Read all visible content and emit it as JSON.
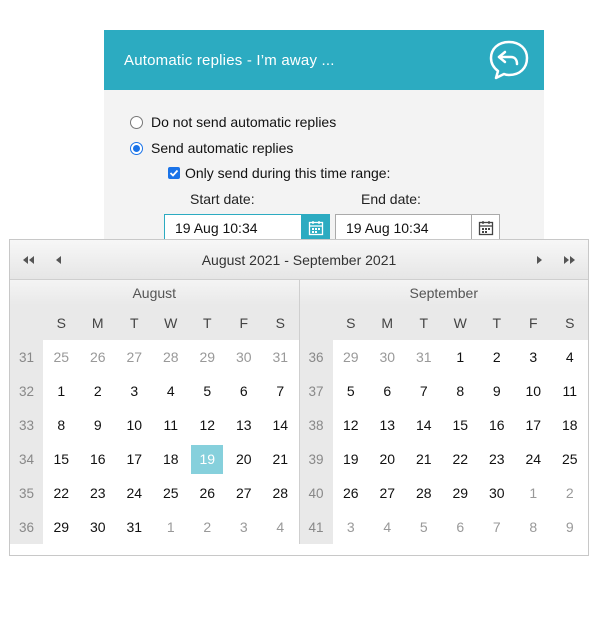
{
  "dialog": {
    "title": "Automatic replies - I’m away ...",
    "options": [
      {
        "label": "Do not send automatic replies",
        "checked": false
      },
      {
        "label": "Send automatic replies",
        "checked": true
      }
    ],
    "time_range_label": "Only send during this time range:",
    "time_range_checked": true,
    "start_label": "Start date:",
    "start_value": "19 Aug 10:34",
    "end_label": "End date:",
    "end_value": "19 Aug 10:34"
  },
  "colors": {
    "header": "#2cabc1",
    "selected_day": "#86d0dc",
    "accent": "#1a73e8"
  },
  "calendar": {
    "title": "August 2021 - September 2021",
    "weekday_headers": [
      "S",
      "M",
      "T",
      "W",
      "T",
      "F",
      "S"
    ],
    "months": [
      {
        "name": "August",
        "weeks": [
          "31",
          "32",
          "33",
          "34",
          "35",
          "36"
        ],
        "days": [
          [
            "25",
            "26",
            "27",
            "28",
            "29",
            "30",
            "31"
          ],
          [
            "1",
            "2",
            "3",
            "4",
            "5",
            "6",
            "7"
          ],
          [
            "8",
            "9",
            "10",
            "11",
            "12",
            "13",
            "14"
          ],
          [
            "15",
            "16",
            "17",
            "18",
            "19",
            "20",
            "21"
          ],
          [
            "22",
            "23",
            "24",
            "25",
            "26",
            "27",
            "28"
          ],
          [
            "29",
            "30",
            "31",
            "1",
            "2",
            "3",
            "4"
          ]
        ],
        "other": [
          [
            1,
            1,
            1,
            1,
            1,
            1,
            1
          ],
          [
            0,
            0,
            0,
            0,
            0,
            0,
            0
          ],
          [
            0,
            0,
            0,
            0,
            0,
            0,
            0
          ],
          [
            0,
            0,
            0,
            0,
            0,
            0,
            0
          ],
          [
            0,
            0,
            0,
            0,
            0,
            0,
            0
          ],
          [
            0,
            0,
            0,
            1,
            1,
            1,
            1
          ]
        ],
        "selected": [
          3,
          4
        ]
      },
      {
        "name": "September",
        "weeks": [
          "36",
          "37",
          "38",
          "39",
          "40",
          "41"
        ],
        "days": [
          [
            "29",
            "30",
            "31",
            "1",
            "2",
            "3",
            "4"
          ],
          [
            "5",
            "6",
            "7",
            "8",
            "9",
            "10",
            "11"
          ],
          [
            "12",
            "13",
            "14",
            "15",
            "16",
            "17",
            "18"
          ],
          [
            "19",
            "20",
            "21",
            "22",
            "23",
            "24",
            "25"
          ],
          [
            "26",
            "27",
            "28",
            "29",
            "30",
            "1",
            "2"
          ],
          [
            "3",
            "4",
            "5",
            "6",
            "7",
            "8",
            "9"
          ]
        ],
        "other": [
          [
            1,
            1,
            1,
            0,
            0,
            0,
            0
          ],
          [
            0,
            0,
            0,
            0,
            0,
            0,
            0
          ],
          [
            0,
            0,
            0,
            0,
            0,
            0,
            0
          ],
          [
            0,
            0,
            0,
            0,
            0,
            0,
            0
          ],
          [
            0,
            0,
            0,
            0,
            0,
            1,
            1
          ],
          [
            1,
            1,
            1,
            1,
            1,
            1,
            1
          ]
        ],
        "selected": null
      }
    ]
  }
}
